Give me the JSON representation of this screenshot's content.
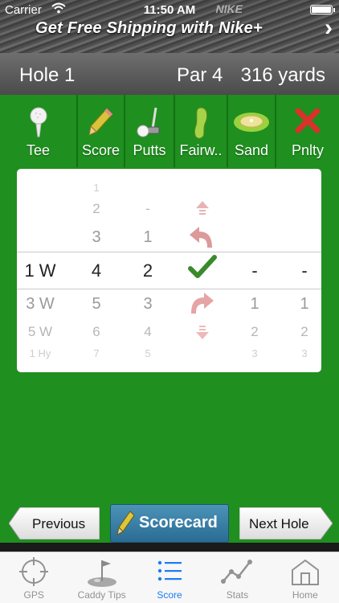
{
  "status_bar": {
    "carrier": "Carrier",
    "time": "11:50 AM"
  },
  "ad": {
    "text": "Get Free Shipping with Nike+",
    "brand": "NIKE",
    "arrow": "›"
  },
  "hole": {
    "title": "Hole 1",
    "par": "Par 4",
    "yards": "316 yards"
  },
  "tools": [
    {
      "label": "Tee",
      "icon": "golf-tee-icon"
    },
    {
      "label": "Score",
      "icon": "pencil-icon"
    },
    {
      "label": "Putts",
      "icon": "putter-icon"
    },
    {
      "label": "Fairw..",
      "icon": "fairway-icon"
    },
    {
      "label": "Sand",
      "icon": "sand-bunker-icon"
    },
    {
      "label": "Pnlty",
      "icon": "penalty-x-icon"
    }
  ],
  "picker": {
    "tee": [
      "1 W",
      "3 W",
      "5 W",
      "1 Hy"
    ],
    "score": [
      "1",
      "2",
      "3",
      "4",
      "5",
      "6",
      "7"
    ],
    "putts": [
      "-",
      "1",
      "2",
      "3",
      "4",
      "5"
    ],
    "fairway": [
      "long",
      "left",
      "hit",
      "right",
      "short"
    ],
    "sand": [
      "-",
      "1",
      "2",
      "3"
    ],
    "penalty": [
      "-",
      "1",
      "2",
      "3"
    ]
  },
  "buttons": {
    "previous": "Previous",
    "scorecard": "Scorecard",
    "next": "Next Hole"
  },
  "tabs": [
    {
      "label": "GPS",
      "icon": "crosshair-icon"
    },
    {
      "label": "Caddy Tips",
      "icon": "golf-flag-icon"
    },
    {
      "label": "Score",
      "icon": "list-icon"
    },
    {
      "label": "Stats",
      "icon": "stats-line-icon"
    },
    {
      "label": "Home",
      "icon": "home-icon"
    }
  ],
  "colors": {
    "green": "#1f8f1f",
    "active_tab": "#1a7cf5",
    "scorecard_blue": "#3680a6"
  }
}
